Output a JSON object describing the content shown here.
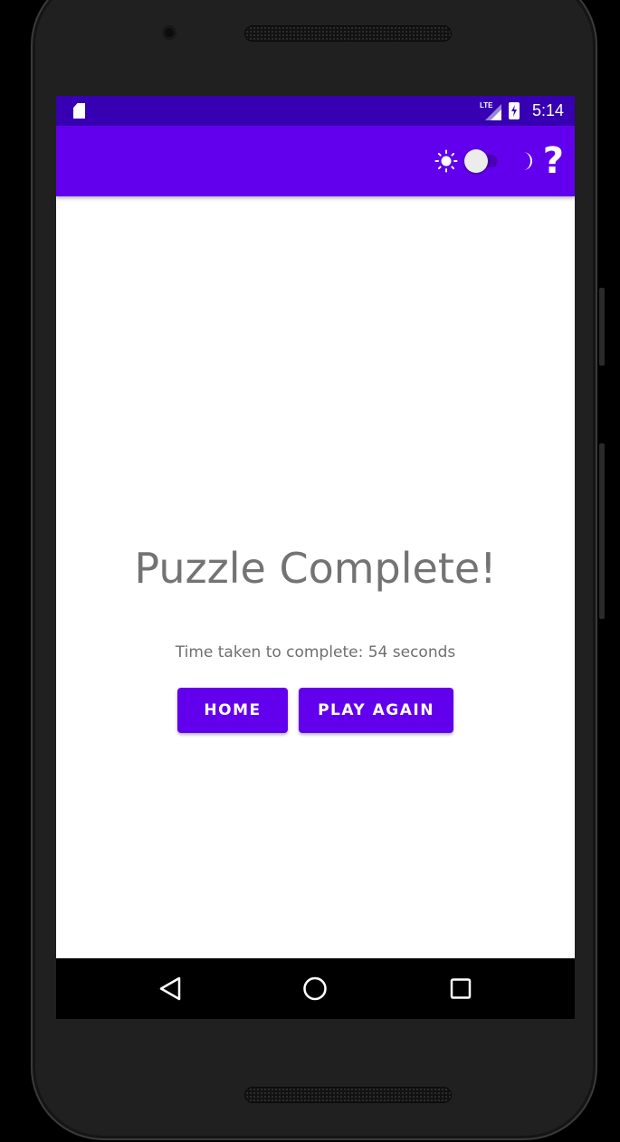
{
  "status_bar": {
    "time": "5:14",
    "network_label": "LTE",
    "icons": [
      "sd-card-icon",
      "lte-signal-icon",
      "battery-charging-icon"
    ]
  },
  "app_bar": {
    "icons": [
      "sun-icon",
      "moon-icon",
      "help-icon"
    ],
    "help_label": "?",
    "theme_switch_on": false
  },
  "main": {
    "title": "Puzzle Complete!",
    "time_taken": "Time taken to complete: 54 seconds",
    "home_button": "HOME",
    "play_again_button": "PLAY AGAIN"
  },
  "nav_bar": {
    "icons": [
      "back-icon",
      "home-icon",
      "recents-icon"
    ]
  },
  "colors": {
    "primary": "#6200ee",
    "primary_dark": "#3700b3",
    "title_text": "#737373",
    "body_text": "#6f6f6f"
  }
}
